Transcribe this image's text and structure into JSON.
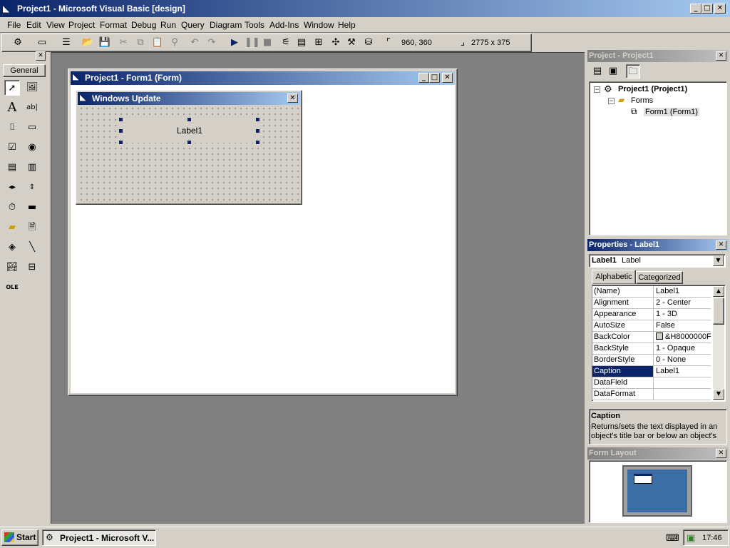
{
  "app": {
    "title": "Project1 - Microsoft Visual Basic [design]"
  },
  "menu": [
    {
      "label": "File",
      "key": "file"
    },
    {
      "label": "Edit",
      "key": "edit"
    },
    {
      "label": "View",
      "key": "view"
    },
    {
      "label": "Project",
      "key": "project"
    },
    {
      "label": "Format",
      "key": "format"
    },
    {
      "label": "Debug",
      "key": "debug"
    },
    {
      "label": "Run",
      "key": "run"
    },
    {
      "label": "Query",
      "key": "query"
    },
    {
      "label": "Diagram",
      "key": "diagram"
    },
    {
      "label": "Tools",
      "key": "tools"
    },
    {
      "label": "Add-Ins",
      "key": "addins"
    },
    {
      "label": "Window",
      "key": "window"
    },
    {
      "label": "Help",
      "key": "help"
    }
  ],
  "toolbar": {
    "position": "960, 360",
    "size": "2775 x 375"
  },
  "toolbox": {
    "tab_label": "General"
  },
  "form_window": {
    "title": "Project1 - Form1 (Form)"
  },
  "design_form": {
    "caption": "Windows Update",
    "label_caption": "Label1"
  },
  "project_explorer": {
    "title": "Project - Project1",
    "root": "Project1 (Project1)",
    "folder": "Forms",
    "item": "Form1 (Form1)"
  },
  "properties": {
    "title": "Properties - Label1",
    "object_name": "Label1",
    "object_type": "Label",
    "tab_alphabetic": "Alphabetic",
    "tab_categorized": "Categorized",
    "rows": [
      {
        "name": "(Name)",
        "value": "Label1"
      },
      {
        "name": "Alignment",
        "value": "2 - Center"
      },
      {
        "name": "Appearance",
        "value": "1 - 3D"
      },
      {
        "name": "AutoSize",
        "value": "False"
      },
      {
        "name": "BackColor",
        "value": "&H8000000F"
      },
      {
        "name": "BackStyle",
        "value": "1 - Opaque"
      },
      {
        "name": "BorderStyle",
        "value": "0 - None"
      },
      {
        "name": "Caption",
        "value": "Label1"
      },
      {
        "name": "DataField",
        "value": ""
      },
      {
        "name": "DataFormat",
        "value": ""
      }
    ],
    "selected_row": 7,
    "desc_title": "Caption",
    "desc_text": "Returns/sets the text displayed in an object's title bar or below an object's"
  },
  "form_layout": {
    "title": "Form Layout"
  },
  "taskbar": {
    "start_label": "Start",
    "task_label": "Project1 - Microsoft V...",
    "clock": "17:46"
  },
  "colors": {
    "active_title": "#0a246a",
    "mdi_background": "#808080",
    "layout_screen": "#3a6ea5"
  }
}
